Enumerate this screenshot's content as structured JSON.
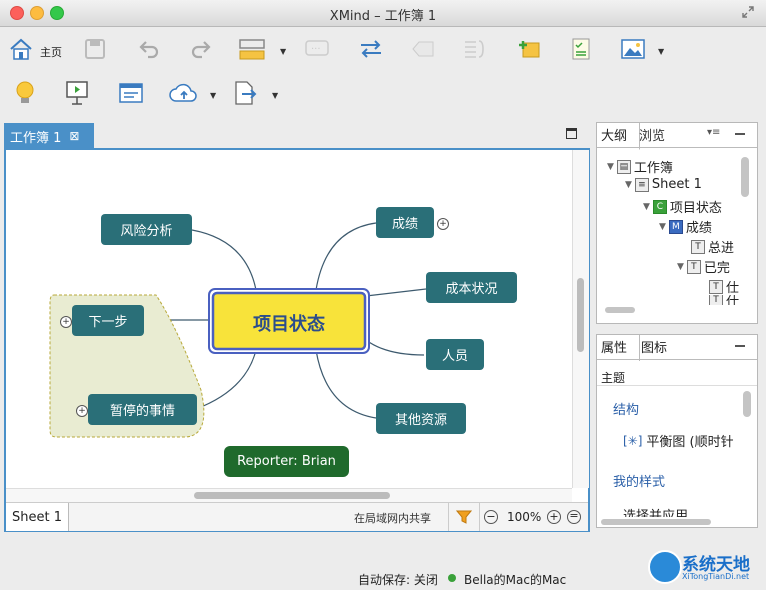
{
  "window": {
    "title": "XMind – 工作簿 1"
  },
  "toolbar": {
    "home_label": "主页"
  },
  "editor": {
    "tab_label": "工作簿 1",
    "sheet_tab": "Sheet 1",
    "share_status": "在局域网内共享",
    "zoom": "100%"
  },
  "map": {
    "central": "项目状态",
    "topics": {
      "risk": "风险分析",
      "next": "下一步",
      "paused": "暂停的事情",
      "results": "成绩",
      "cost": "成本状况",
      "people": "人员",
      "resources": "其他资源"
    },
    "reporter": "Reporter: Brian"
  },
  "outline": {
    "tab_outline": "大纲",
    "tab_browse": "浏览",
    "rows": [
      "工作簿",
      "Sheet 1",
      "项目状态",
      "成绩",
      "总进",
      "已完",
      "仕",
      "仕"
    ]
  },
  "props": {
    "tab_props": "属性",
    "tab_icons": "图标",
    "section_topic": "主题",
    "structure": "结构",
    "structure_value": "平衡图 (顺时针",
    "my_style": "我的样式",
    "apply": "选择并应用"
  },
  "statusbar": {
    "autosave": "自动保存: 关闭",
    "user": "Bella的Mac的Mac"
  },
  "watermark": {
    "text": "系统天地",
    "url": "XiTongTianDi.net"
  }
}
